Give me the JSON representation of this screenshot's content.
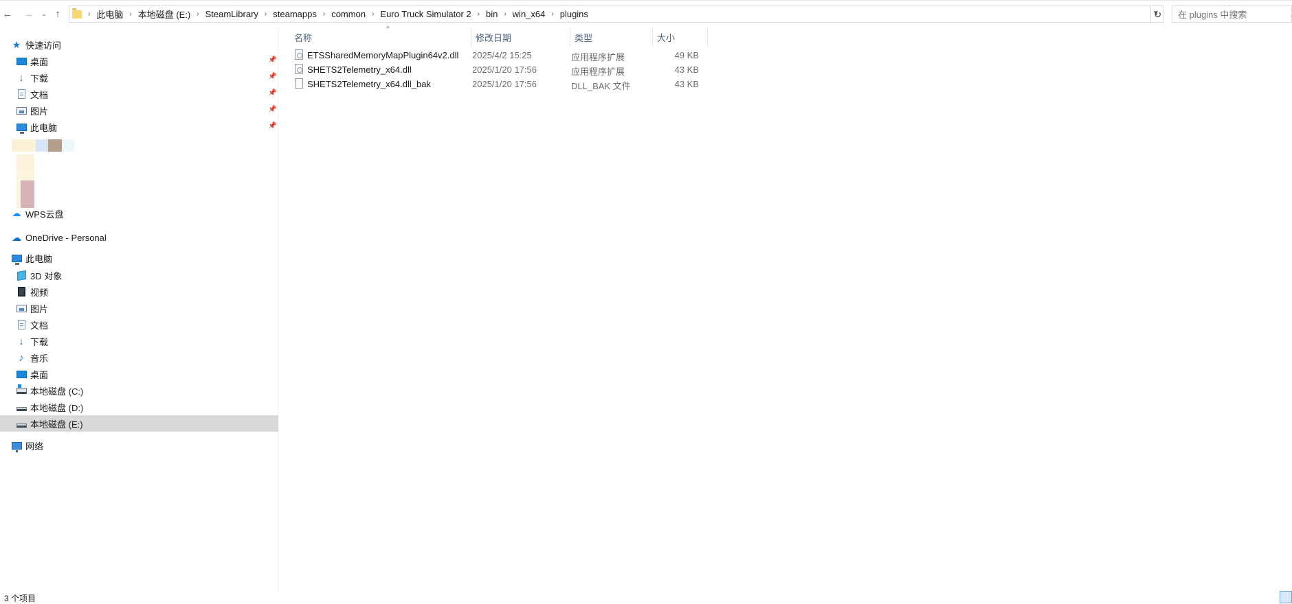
{
  "window": {
    "status_text": "3 个项目"
  },
  "address_bar": {
    "path": [
      "此电脑",
      "本地磁盘 (E:)",
      "SteamLibrary",
      "steamapps",
      "common",
      "Euro Truck Simulator 2",
      "bin",
      "win_x64",
      "plugins"
    ],
    "search_placeholder": "在 plugins 中搜索"
  },
  "sidebar": {
    "quick_access": {
      "label": "快速访问",
      "items": [
        {
          "label": "桌面",
          "icon": "desktop-icon",
          "pinned": true
        },
        {
          "label": "下载",
          "icon": "download-icon",
          "pinned": true
        },
        {
          "label": "文档",
          "icon": "document-icon",
          "pinned": true
        },
        {
          "label": "图片",
          "icon": "picture-icon",
          "pinned": true
        },
        {
          "label": "此电脑",
          "icon": "pc-icon",
          "pinned": true
        }
      ]
    },
    "wps_cloud": "WPS云盘",
    "onedrive": "OneDrive - Personal",
    "this_pc": {
      "label": "此电脑",
      "items": [
        {
          "label": "3D 对象",
          "icon": "3d-objects-icon"
        },
        {
          "label": "视频",
          "icon": "video-icon"
        },
        {
          "label": "图片",
          "icon": "picture-icon"
        },
        {
          "label": "文档",
          "icon": "document-icon"
        },
        {
          "label": "下载",
          "icon": "download-icon"
        },
        {
          "label": "音乐",
          "icon": "music-icon"
        },
        {
          "label": "桌面",
          "icon": "desktop-icon"
        },
        {
          "label": "本地磁盘 (C:)",
          "icon": "drive-c-icon"
        },
        {
          "label": "本地磁盘 (D:)",
          "icon": "drive-icon"
        },
        {
          "label": "本地磁盘 (E:)",
          "icon": "drive-icon",
          "selected": true
        }
      ]
    },
    "network": "网络"
  },
  "file_list": {
    "columns": {
      "name": "名称",
      "date": "修改日期",
      "type": "类型",
      "size": "大小"
    },
    "rows": [
      {
        "name": "ETSSharedMemoryMapPlugin64v2.dll",
        "date": "2025/4/2 15:25",
        "type": "应用程序扩展",
        "size": "49 KB",
        "icon": "dll-file-icon"
      },
      {
        "name": "SHETS2Telemetry_x64.dll",
        "date": "2025/1/20 17:56",
        "type": "应用程序扩展",
        "size": "43 KB",
        "icon": "dll-file-icon"
      },
      {
        "name": "SHETS2Telemetry_x64.dll_bak",
        "date": "2025/1/20 17:56",
        "type": "DLL_BAK 文件",
        "size": "43 KB",
        "icon": "generic-file-icon"
      }
    ]
  }
}
